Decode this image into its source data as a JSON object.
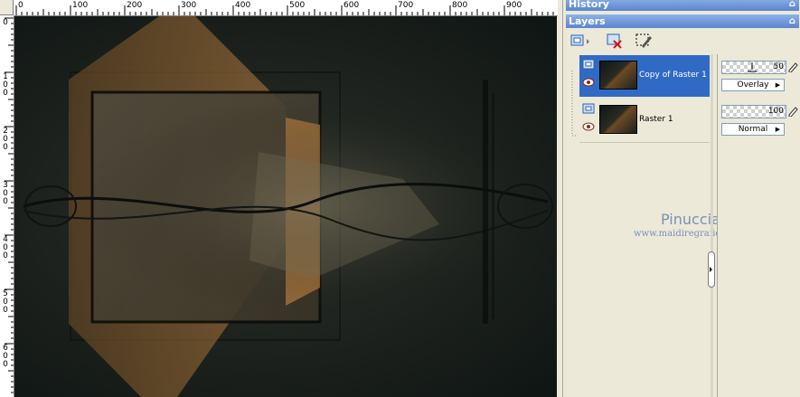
{
  "ruler": {
    "h_labels": [
      "0",
      "100",
      "200",
      "300",
      "400",
      "500",
      "600",
      "700",
      "800",
      "900"
    ],
    "v_labels": [
      "0",
      "1\n0\n0",
      "2\n0\n0",
      "3\n0\n0",
      "4\n0\n0",
      "5\n0\n0",
      "6\n0\n0"
    ]
  },
  "palettes": {
    "history_title": "History",
    "layers_title": "Layers"
  },
  "layers": [
    {
      "name": "Copy of Raster 1",
      "opacity": "50",
      "blend": "Overlay",
      "selected": true
    },
    {
      "name": "Raster 1",
      "opacity": "100",
      "blend": "Normal",
      "selected": false
    }
  ],
  "watermark": {
    "name": "Pinuccia",
    "site": "www.maidiregrafica.eu"
  },
  "colors": {
    "selection": "#316ac5",
    "title_bar": "#5a85cf",
    "panel_bg": "#ece9d8"
  },
  "icons": [
    "new-layer-icon",
    "delete-layer-icon",
    "edit-selection-icon",
    "layer-type-icon",
    "eye-icon",
    "lock-icon",
    "pin-icon"
  ]
}
